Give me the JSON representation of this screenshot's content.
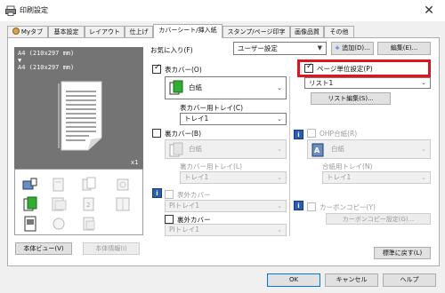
{
  "window": {
    "title": "印刷設定",
    "close_label": "✕"
  },
  "tabs": [
    "Myタブ",
    "基本設定",
    "レイアウト",
    "仕上げ",
    "カバーシート/挿入紙",
    "スタンプ/ページ印字",
    "画像品質",
    "その他"
  ],
  "preview": {
    "size_line1": "A4 (210x297 mm)",
    "arrow": "▼",
    "size_line2": "A4 (210x297 mm)",
    "copies": "x1"
  },
  "left_buttons": {
    "view": "本体ビュー(V)",
    "info": "本体情報(I)"
  },
  "favorites": {
    "label": "お気に入り(F)",
    "value": "ユーザー設定",
    "add_button": "追加(D)...",
    "edit_button": "編集(E)..."
  },
  "front_cover": {
    "checkbox_label": "表カバー(O)",
    "paper_value": "白紙",
    "tray_label": "表カバー用トレイ(C)",
    "tray_value": "トレイ1"
  },
  "back_cover": {
    "checkbox_label": "裏カバー(B)",
    "paper_value": "白紙",
    "tray_label": "裏カバー用トレイ(L)",
    "tray_value": "トレイ1"
  },
  "front_outer": {
    "checkbox_label": "表外カバー",
    "value": "PIトレイ1"
  },
  "back_outer": {
    "checkbox_label": "裏外カバー",
    "value": "PIトレイ1"
  },
  "per_page": {
    "checkbox_label": "ページ単位設定(P)",
    "list_value": "リスト1",
    "list_edit_button": "リスト編集(S)..."
  },
  "ohp": {
    "checkbox_label": "OHP合紙(R)",
    "paper_value": "白紙",
    "tray_label": "合紙用トレイ(N)",
    "tray_value": "トレイ1"
  },
  "carbon": {
    "checkbox_label": "カーボンコピー(Y)",
    "button": "カーボンコピー設定(G)..."
  },
  "restore_button": "標準に戻す(L)",
  "bottom_buttons": {
    "ok": "OK",
    "cancel": "キャンセル",
    "help": "ヘルプ"
  },
  "colors": {
    "highlight": "#e0141e",
    "preview_bg": "#747474",
    "info_icon": "#2a5db0"
  }
}
